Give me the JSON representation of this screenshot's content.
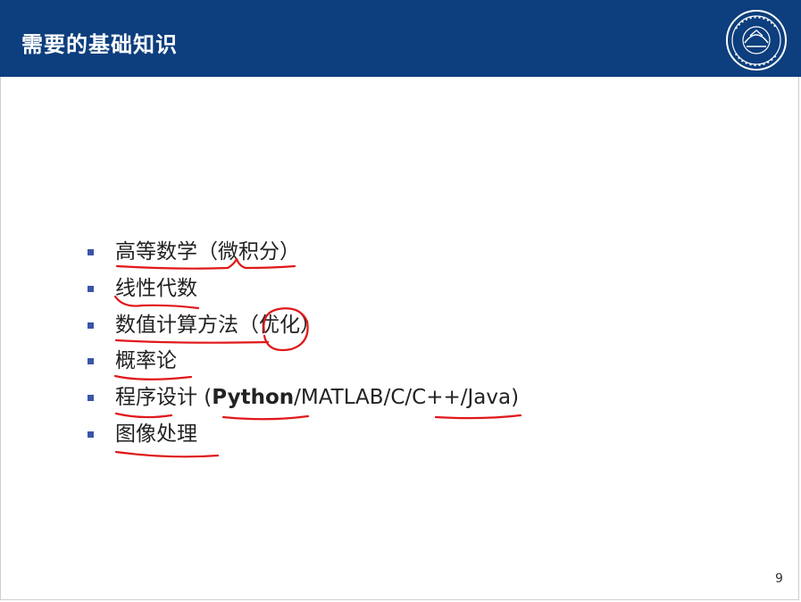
{
  "slide": {
    "title": "需要的基础知识",
    "page_number": "9",
    "items": [
      {
        "text": "高等数学（微积分）"
      },
      {
        "text": "线性代数"
      },
      {
        "text": "数值计算方法（优化）"
      },
      {
        "text": "概率论"
      },
      {
        "prefix": "程序设计 (",
        "bold": "Python",
        "suffix": "/MATLAB/C/C++/Java)"
      },
      {
        "text": "图像处理"
      }
    ]
  },
  "colors": {
    "header": "#0d3e7d",
    "bullet": "#3a56a8",
    "annotation": "#e0181b"
  },
  "icons": {
    "logo": "university-seal-icon"
  }
}
